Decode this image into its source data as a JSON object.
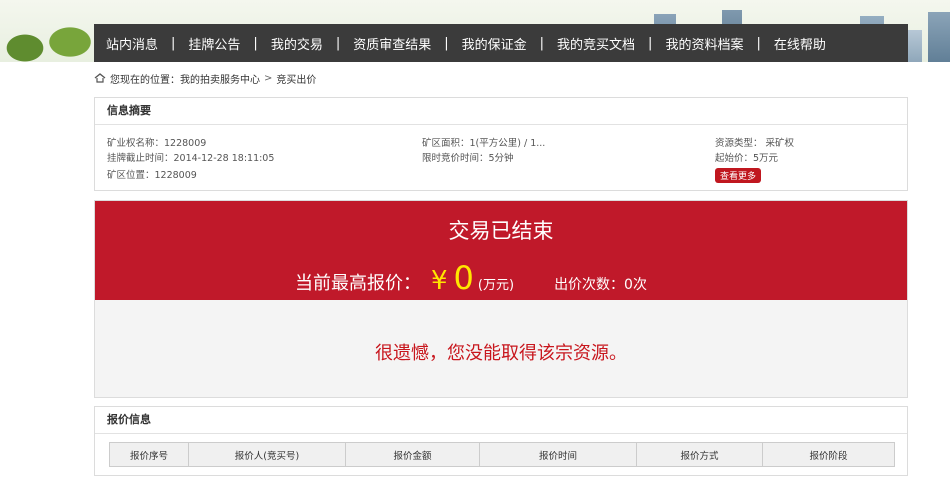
{
  "nav": {
    "items": [
      "站内消息",
      "挂牌公告",
      "我的交易",
      "资质审查结果",
      "我的保证金",
      "我的竞买文档",
      "我的资料档案",
      "在线帮助"
    ],
    "separator": "|"
  },
  "breadcrumb": {
    "prefix": "您现在的位置：",
    "link": "我的拍卖服务中心",
    "arrow": ">",
    "current": "竞买出价"
  },
  "summary": {
    "title": "信息摘要",
    "license_name": "矿业权名称：1228009",
    "deadline": "挂牌截止时间：2014-12-28 18:11:05",
    "location": "矿区位置：1228009",
    "area": "矿区面积：1(平方公里) / 1...",
    "time_limit": "限时竞价时间：5分钟",
    "resource_type": "资源类型： 采矿权",
    "start_price": "起始价：5万元",
    "more_button": "查看更多"
  },
  "status": {
    "ended": "交易已结束",
    "price_label": "当前最高报价：",
    "currency": "¥",
    "price_value": "0",
    "unit": "(万元)",
    "bid_count": "出价次数：0次",
    "message": "很遗憾，您没能取得该宗资源。"
  },
  "bids": {
    "title": "报价信息",
    "columns": [
      "报价序号",
      "报价人(竞买号)",
      "报价金额",
      "报价时间",
      "报价方式",
      "报价阶段"
    ]
  },
  "colors": {
    "nav_bg": "#3b3b3b",
    "accent_red": "#c0192a",
    "price_yellow": "#ffe600",
    "message_red": "#c8161d"
  }
}
